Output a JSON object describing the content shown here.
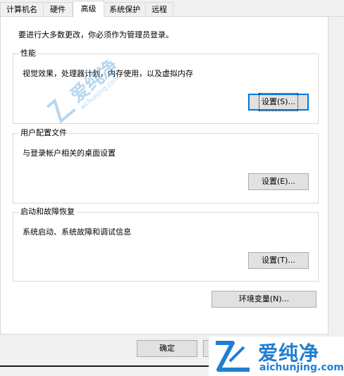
{
  "tabs": [
    {
      "label": "计算机名"
    },
    {
      "label": "硬件"
    },
    {
      "label": "高级"
    },
    {
      "label": "系统保护"
    },
    {
      "label": "远程"
    }
  ],
  "notice": "要进行大多数更改，你必须作为管理员登录。",
  "performance": {
    "title": "性能",
    "description": "视觉效果，处理器计划，内存使用，以及虚拟内存",
    "button": "设置(S)..."
  },
  "user_profiles": {
    "title": "用户配置文件",
    "description": "与登录帐户相关的桌面设置",
    "button": "设置(E)..."
  },
  "startup_recovery": {
    "title": "启动和故障恢复",
    "description": "系统启动、系统故障和调试信息",
    "button": "设置(T)..."
  },
  "env_button": "环境变量(N)...",
  "ok_button": "确定",
  "watermark": {
    "cn": "爱纯净",
    "en": "aichunjing.com"
  },
  "colors": {
    "brand": "#1f7fd0",
    "focus": "#0078d7"
  }
}
